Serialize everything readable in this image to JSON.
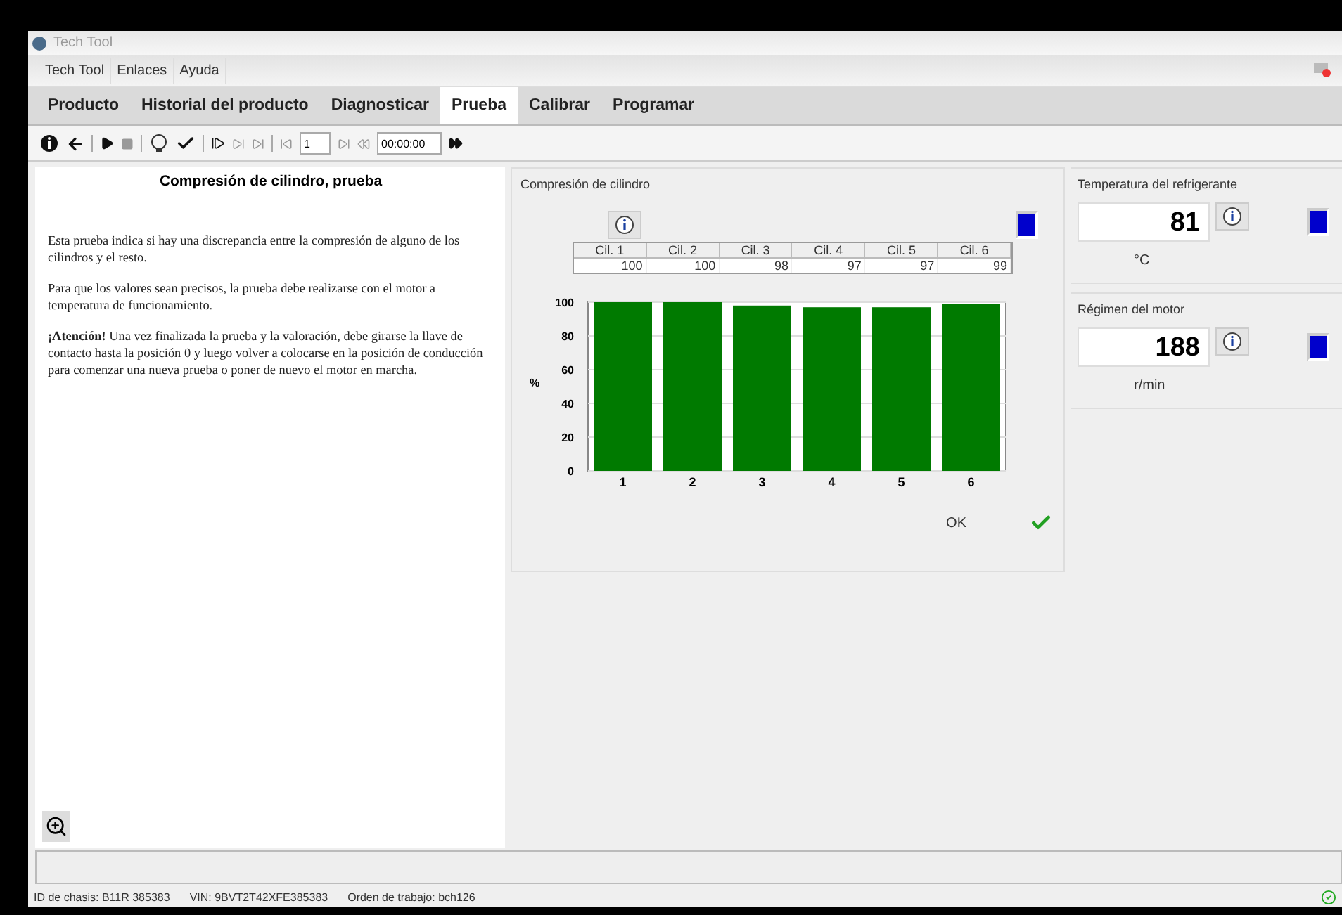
{
  "window": {
    "title": "Tech Tool"
  },
  "menu": [
    {
      "label": "Tech Tool"
    },
    {
      "label": "Enlaces"
    },
    {
      "label": "Ayuda"
    }
  ],
  "tabs": [
    {
      "label": "Producto",
      "selected": false
    },
    {
      "label": "Historial del producto",
      "selected": false
    },
    {
      "label": "Diagnosticar",
      "selected": false
    },
    {
      "label": "Prueba",
      "selected": true
    },
    {
      "label": "Calibrar",
      "selected": false
    },
    {
      "label": "Programar",
      "selected": false
    }
  ],
  "toolbar": {
    "step_field": "1",
    "time_field": "00:00:00"
  },
  "info": {
    "title": "Compresión de cilindro, prueba",
    "paragraphs": [
      "Esta prueba indica si hay una discrepancia entre la compresión de alguno de los cilindros y el resto.",
      "Para que los valores sean precisos, la prueba debe realizarse con el motor a temperatura de funcionamiento.",
      "**¡Atención!** Una vez finalizada la prueba y la valoración, debe girarse la llave de contacto hasta la posición 0 y luego volver a colocarse en la posición de conducción para comenzar una nueva prueba o poner de nuevo el motor en marcha."
    ]
  },
  "compression": {
    "title": "Compresión de cilindro",
    "table": {
      "columns": [
        "Cil. 1",
        "Cil. 2",
        "Cil. 3",
        "Cil. 4",
        "Cil. 5",
        "Cil. 6"
      ],
      "values": [
        "100",
        "100",
        "98",
        "97",
        "97",
        "99"
      ]
    },
    "chart_data": {
      "type": "bar",
      "ylabel": "%",
      "categories": [
        "1",
        "2",
        "3",
        "4",
        "5",
        "6"
      ],
      "series": [
        {
          "color": "#007a00",
          "values": [
            100,
            100,
            98,
            97,
            97,
            99
          ]
        }
      ],
      "grid": true,
      "ylim": [
        0,
        100
      ],
      "yticks": [
        0,
        20,
        40,
        60,
        80,
        100
      ]
    },
    "result": "OK",
    "passed": true
  },
  "gauges": [
    {
      "title": "Temperatura del refrigerante",
      "value": "81",
      "unit": "°C"
    },
    {
      "title": "Régimen del motor",
      "value": "188",
      "unit": "r/min"
    }
  ],
  "status_bar": [
    "ID de chasis: B11R 385383",
    "VIN: 9BVT2T42XFE385383",
    "Orden de trabajo: bch126"
  ]
}
